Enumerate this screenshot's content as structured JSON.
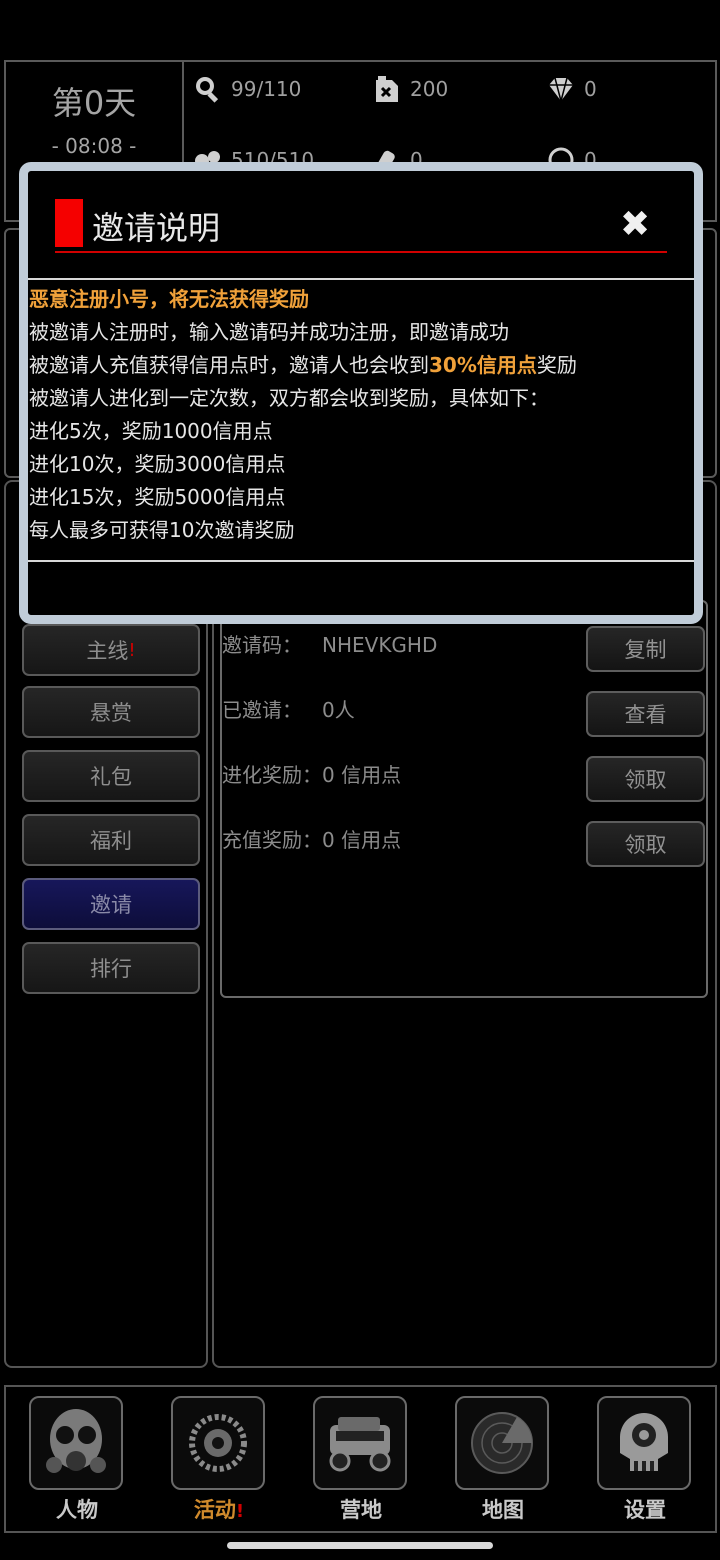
{
  "header": {
    "day": "第0天",
    "clock": "- 08:08 -",
    "stats": {
      "food": "99/110",
      "fuel": "200",
      "gems": "0",
      "water": "510/510",
      "ammo": "0",
      "other": "0"
    }
  },
  "modal": {
    "title": "邀请说明",
    "warning": "恶意注册小号，将无法获得奖励",
    "line1": "被邀请人注册时，输入邀请码并成功注册，即邀请成功",
    "line2_pre": "被邀请人充值获得信用点时，邀请人也会收到",
    "line2_hl": "30%信用点",
    "line2_post": "奖励",
    "line3": "被邀请人进化到一定次数，双方都会收到奖励，具体如下：",
    "line4": "进化5次，奖励1000信用点",
    "line5": "进化10次，奖励3000信用点",
    "line6": "进化15次，奖励5000信用点",
    "line7": "每人最多可获得10次邀请奖励"
  },
  "menu": {
    "main": "主线",
    "main_badge": "!",
    "bounty": "悬赏",
    "gift": "礼包",
    "welfare": "福利",
    "invite": "邀请",
    "rank": "排行"
  },
  "invite": {
    "code_label": "邀请码：",
    "code_value": "NHEVKGHD",
    "copy_btn": "复制",
    "invited_label": "已邀请：",
    "invited_value": "0人",
    "view_btn": "查看",
    "evo_label": "进化奖励：",
    "evo_value": "0 信用点",
    "claim_btn_1": "领取",
    "recharge_label": "充值奖励：",
    "recharge_value": "0 信用点",
    "claim_btn_2": "领取"
  },
  "nav": {
    "character": "人物",
    "activity": "活动",
    "activity_badge": "!",
    "camp": "营地",
    "map": "地图",
    "settings": "设置"
  },
  "colors": {
    "accent_orange": "#f0a13a",
    "title_red": "#f50000",
    "active_tab_blue": "#17175a"
  }
}
